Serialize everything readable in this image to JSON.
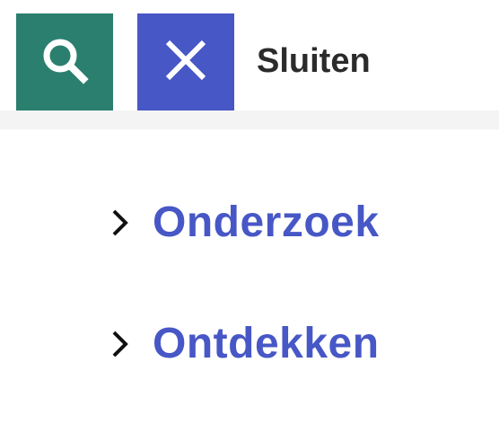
{
  "header": {
    "search_icon": "search-icon",
    "close_icon": "close-icon",
    "close_label": "Sluiten",
    "colors": {
      "search_button": "#2a7f6e",
      "close_button": "#4757c6",
      "close_text": "#2b2b2b"
    }
  },
  "menu": {
    "items": [
      {
        "label": "Onderzoek",
        "icon": "chevron-right-icon"
      },
      {
        "label": "Ontdekken",
        "icon": "chevron-right-icon"
      }
    ],
    "link_color": "#4757c6"
  }
}
